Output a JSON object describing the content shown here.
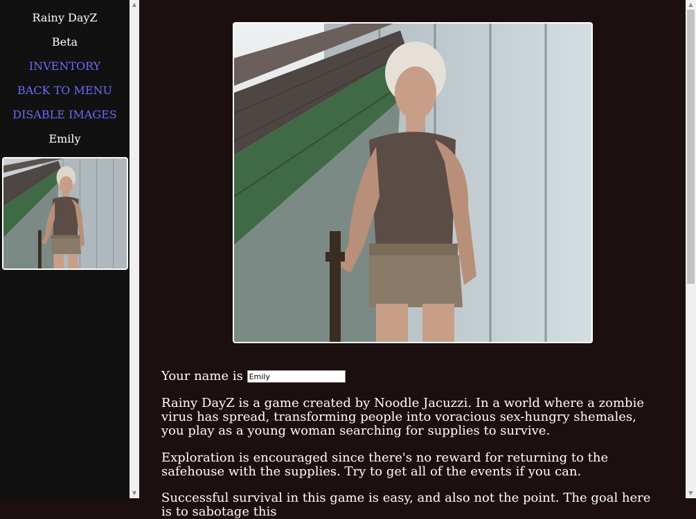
{
  "sidebar": {
    "title": "Rainy DayZ",
    "subtitle": "Beta",
    "links": [
      "INVENTORY",
      "BACK TO MENU",
      "DISABLE IMAGES"
    ],
    "character_name": "Emily"
  },
  "main": {
    "name_prompt": "Your name is",
    "name_value": "Emily",
    "paragraphs": [
      "Rainy DayZ is a game created by Noodle Jacuzzi. In a world where a zombie virus has spread, transforming people into voracious sex-hungry shemales, you play as a young woman searching for supplies to survive.",
      "Exploration is encouraged since there's no reward for returning to the safehouse with the supplies. Try to get all of the events if you can.",
      "Successful survival in this game is easy, and also not the point. The goal here is to sabotage this"
    ]
  },
  "icons": {
    "scroll_up": "scroll-up-arrow-icon",
    "scroll_down": "scroll-down-arrow-icon"
  },
  "colors": {
    "sidebar_bg": "#111111",
    "main_bg": "#1c0f0f",
    "link": "#6a6aff",
    "text": "#ffffff"
  }
}
